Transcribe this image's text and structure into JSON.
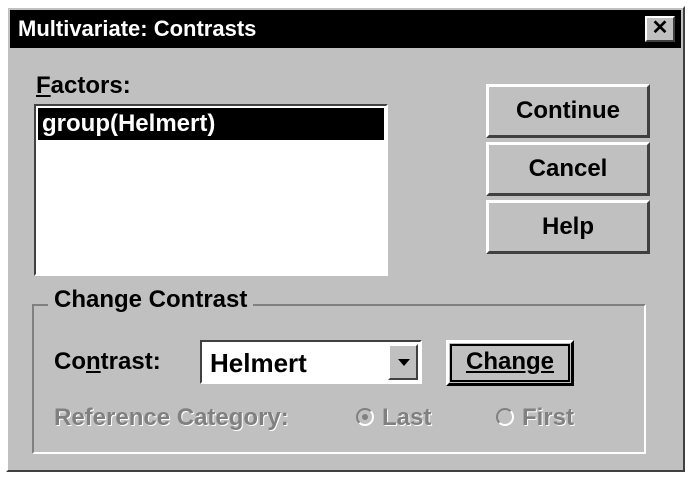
{
  "window": {
    "title": "Multivariate: Contrasts",
    "close_glyph": "✕"
  },
  "factors": {
    "label_mnemonic": "F",
    "label_rest": "actors:",
    "items": [
      "group(Helmert)"
    ]
  },
  "buttons": {
    "continue": "Continue",
    "cancel": "Cancel",
    "help": "Help"
  },
  "change_contrast": {
    "group_title": "Change Contrast",
    "contrast_label_pre": "Co",
    "contrast_label_mnemonic": "n",
    "contrast_label_post": "trast:",
    "contrast_value": "Helmert",
    "change_button_label": "Change",
    "reference_category_label": "Reference Category:",
    "reference_last_label": "Last",
    "reference_first_label": "First",
    "reference_selected": "Last"
  },
  "colors": {
    "face": "#c0c0c0",
    "title_bar": "#000000",
    "disabled_text": "#808080"
  }
}
